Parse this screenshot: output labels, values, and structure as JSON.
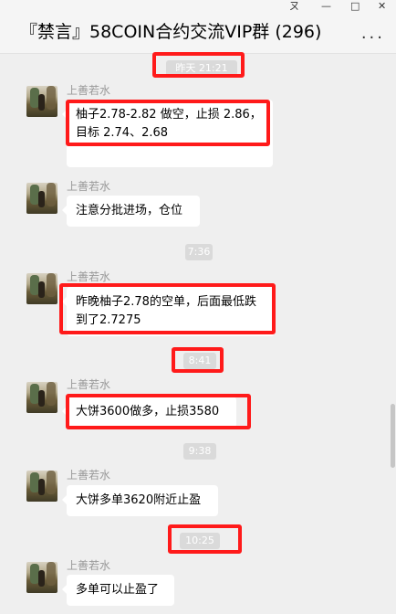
{
  "window": {
    "pin_label": "ㄡ",
    "minimize_label": "—",
    "maximize_label": "□",
    "close_label": "✕"
  },
  "header": {
    "title": "『禁言』58COIN合约交流VIP群 (296)",
    "more_label": "..."
  },
  "messages": [
    {
      "time": "昨天 21:21",
      "sender": "上善若水",
      "lines": [
        "柚子2.78-2.82 做空，止损 2.86，",
        "目标 2.74、2.68"
      ]
    },
    {
      "time": "",
      "sender": "上善若水",
      "lines": [
        "注意分批进场，仓位"
      ]
    },
    {
      "time": "7:36",
      "sender": "上善若水",
      "lines": [
        "昨晚柚子2.78的空单，后面最低跌",
        "到了2.7275"
      ]
    },
    {
      "time": "8:41",
      "sender": "上善若水",
      "lines": [
        "大饼3600做多，止损3580"
      ]
    },
    {
      "time": "9:38",
      "sender": "上善若水",
      "lines": [
        "大饼多单3620附近止盈"
      ]
    },
    {
      "time": "10:25",
      "sender": "上善若水",
      "lines": [
        "多单可以止盈了"
      ]
    }
  ],
  "colors": {
    "highlight": "#ff1a1a",
    "background": "#efefef",
    "bubble": "#ffffff"
  }
}
